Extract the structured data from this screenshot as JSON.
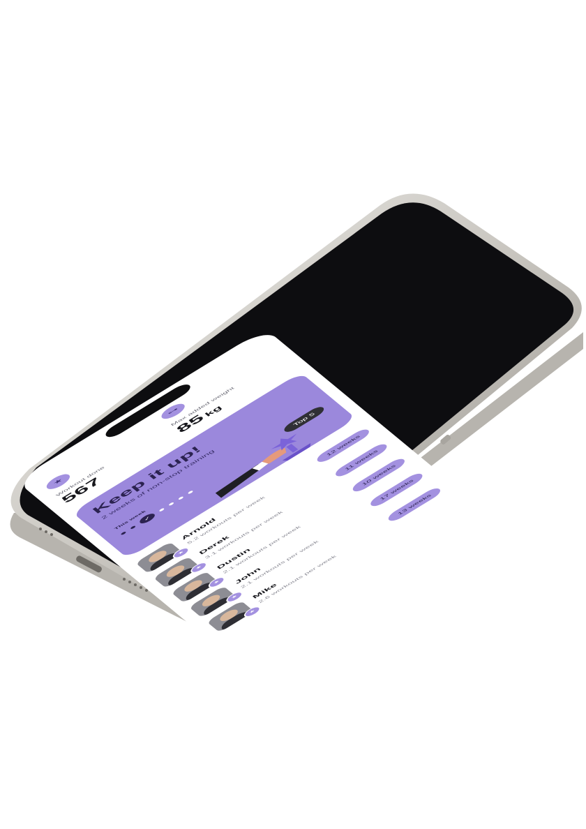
{
  "stats": {
    "workouts": {
      "icon": "star-icon",
      "label": "Workout done",
      "value": "567"
    },
    "weight": {
      "icon": "dumbbell-icon",
      "label": "Max added weight",
      "value": "85",
      "unit": "kg"
    }
  },
  "banner": {
    "title": "Keep it up!",
    "subtitle": "2 weeks of non-stop training",
    "week_label": "This week",
    "current_day_icon": "check-icon",
    "badge": "Top 5",
    "accent": "#9b88dc"
  },
  "leaderboard": [
    {
      "name": "Arnold",
      "workouts": "5.2 workouts per week",
      "weeks": "12 weeks"
    },
    {
      "name": "Derek",
      "workouts": "3.1 workouts per week",
      "weeks": "11 weeks"
    },
    {
      "name": "Dustin",
      "workouts": "2.1 workouts per week",
      "weeks": "10 weeks"
    },
    {
      "name": "John",
      "workouts": "2.1 workouts per week",
      "weeks": "17 weeks"
    },
    {
      "name": "Mike",
      "workouts": "2.6 workouts per week",
      "weeks": "13 weeks"
    }
  ],
  "colors": {
    "accent": "#a391e0",
    "dark": "#17171c",
    "frame": "#d8d6d2"
  }
}
